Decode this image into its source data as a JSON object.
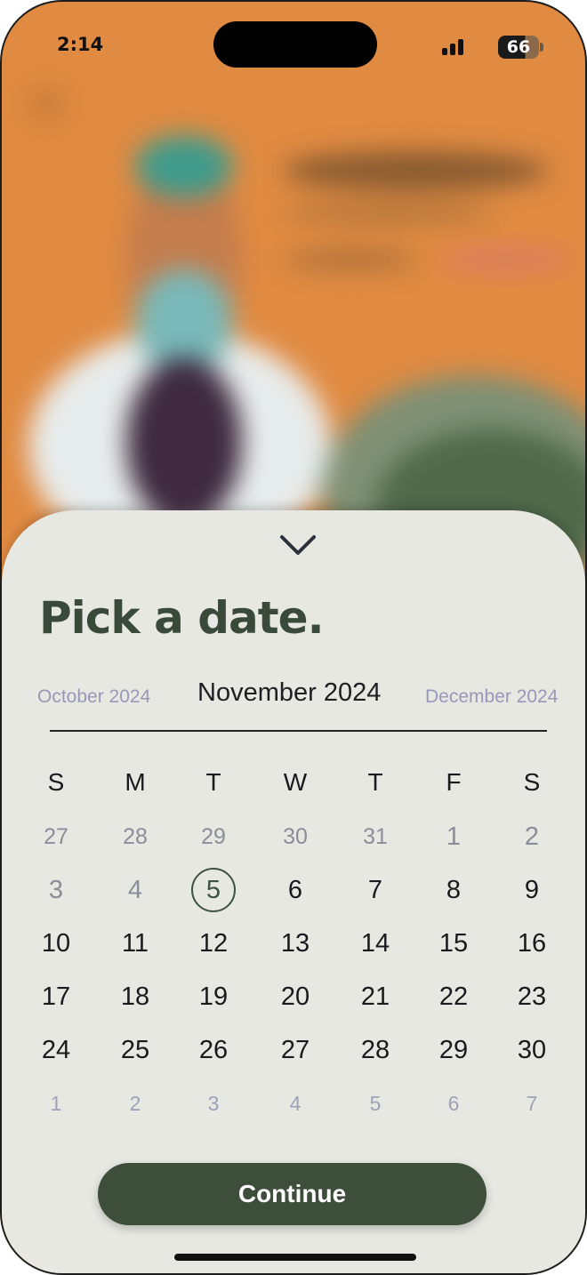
{
  "status_bar": {
    "time": "2:14",
    "battery": "66"
  },
  "sheet": {
    "title": "Pick a date.",
    "collapse_icon": "chevron-down-icon"
  },
  "calendar": {
    "prev_month": "October 2024",
    "current_month": "November 2024",
    "next_month": "December 2024",
    "weekdays": [
      "S",
      "M",
      "T",
      "W",
      "T",
      "F",
      "S"
    ],
    "selected_day": "5",
    "weeks": [
      [
        "27",
        "28",
        "29",
        "30",
        "31",
        "1",
        "2"
      ],
      [
        "3",
        "4",
        "5",
        "6",
        "7",
        "8",
        "9"
      ],
      [
        "10",
        "11",
        "12",
        "13",
        "14",
        "15",
        "16"
      ],
      [
        "17",
        "18",
        "19",
        "20",
        "21",
        "22",
        "23"
      ],
      [
        "24",
        "25",
        "26",
        "27",
        "28",
        "29",
        "30"
      ],
      [
        "1",
        "2",
        "3",
        "4",
        "5",
        "6",
        "7"
      ]
    ]
  },
  "actions": {
    "continue_label": "Continue"
  },
  "colors": {
    "background_orange": "#e18b42",
    "sheet": "#e7e8e2",
    "title_green": "#3a4a3a",
    "button_green": "#3d4e3b",
    "muted_month": "#9a97b8"
  }
}
